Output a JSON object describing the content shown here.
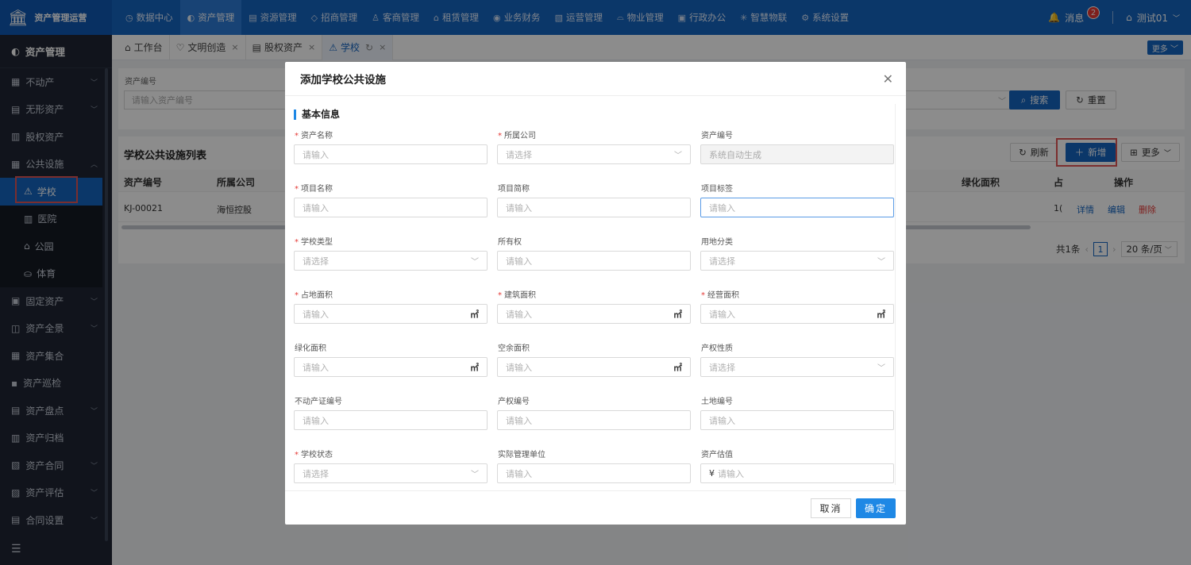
{
  "app": {
    "title": "资产管理运营",
    "logo_icon": "bank-icon"
  },
  "topnav": [
    {
      "label": "数据中心",
      "icon": "◷"
    },
    {
      "label": "资产管理",
      "icon": "◐",
      "active": true
    },
    {
      "label": "资源管理",
      "icon": "▤"
    },
    {
      "label": "招商管理",
      "icon": "◇"
    },
    {
      "label": "客商管理",
      "icon": "♙"
    },
    {
      "label": "租赁管理",
      "icon": "⌂"
    },
    {
      "label": "业务财务",
      "icon": "◉"
    },
    {
      "label": "运营管理",
      "icon": "▧"
    },
    {
      "label": "物业管理",
      "icon": "⌓"
    },
    {
      "label": "行政办公",
      "icon": "▣"
    },
    {
      "label": "智慧物联",
      "icon": "✳"
    },
    {
      "label": "系统设置",
      "icon": "⚙"
    }
  ],
  "topright": {
    "messages": "消息",
    "message_count": "2",
    "user": "测试01"
  },
  "sidebar": {
    "title": "资产管理",
    "items": [
      {
        "label": "不动产",
        "icon": "▦",
        "chevron": "﹀"
      },
      {
        "label": "无形资产",
        "icon": "▤",
        "chevron": "﹀"
      },
      {
        "label": "股权资产",
        "icon": "▥",
        "chevron": ""
      },
      {
        "label": "公共设施",
        "icon": "▦",
        "chevron": "︿"
      }
    ],
    "subitems": [
      {
        "label": "学校",
        "icon": "⚠",
        "active": true
      },
      {
        "label": "医院",
        "icon": "▥"
      },
      {
        "label": "公园",
        "icon": "⌂"
      },
      {
        "label": "体育",
        "icon": "⛀"
      }
    ],
    "items2": [
      {
        "label": "固定资产",
        "icon": "▣",
        "chevron": "﹀"
      },
      {
        "label": "资产全景",
        "icon": "◫",
        "chevron": "﹀"
      },
      {
        "label": "资产集合",
        "icon": "▦",
        "chevron": ""
      },
      {
        "label": "资产巡检",
        "icon": "▪",
        "chevron": ""
      },
      {
        "label": "资产盘点",
        "icon": "▤",
        "chevron": "﹀"
      },
      {
        "label": "资产归档",
        "icon": "▥",
        "chevron": ""
      },
      {
        "label": "资产合同",
        "icon": "▧",
        "chevron": "﹀"
      },
      {
        "label": "资产评估",
        "icon": "▨",
        "chevron": "﹀"
      },
      {
        "label": "合同设置",
        "icon": "▤",
        "chevron": "﹀"
      }
    ],
    "collapse_icon": "☰"
  },
  "tabs": [
    {
      "label": "工作台",
      "icon": "⌂",
      "close": ""
    },
    {
      "label": "文明创造",
      "icon": "♡",
      "close": "×"
    },
    {
      "label": "股权资产",
      "icon": "▤",
      "close": "×"
    },
    {
      "label": "学校",
      "icon": "⚠",
      "close": "×",
      "active": true,
      "refresh": "↻"
    }
  ],
  "tabs_more": "更多 ﹀",
  "search": {
    "label": "资产编号",
    "placeholder": "请输入资产编号",
    "search_btn": "搜索",
    "reset_btn": "重置"
  },
  "list": {
    "title": "学校公共设施列表",
    "refresh_btn": "刷新",
    "add_btn": "新增",
    "more_btn": "更多",
    "columns": {
      "c1": "资产编号",
      "c2": "所属公司",
      "c3": "绿化面积",
      "c4": "占",
      "c5": "操作"
    },
    "row": {
      "code": "KJ-00021",
      "company": "海恒控股",
      "partial": "1(",
      "detail": "详情",
      "edit": "编辑",
      "delete": "删除"
    },
    "pager": {
      "total": "共1条",
      "page": "1",
      "size": "20 条/页"
    }
  },
  "modal": {
    "title": "添加学校公共设施",
    "section": "基本信息",
    "fields": [
      {
        "label": "资产名称",
        "required": true,
        "placeholder": "请输入",
        "kind": "input"
      },
      {
        "label": "所属公司",
        "required": true,
        "placeholder": "请选择",
        "kind": "select"
      },
      {
        "label": "资产编号",
        "required": false,
        "placeholder": "系统自动生成",
        "kind": "disabled"
      },
      {
        "label": "项目名称",
        "required": true,
        "placeholder": "请输入",
        "kind": "input"
      },
      {
        "label": "项目简称",
        "required": false,
        "placeholder": "请输入",
        "kind": "input"
      },
      {
        "label": "项目标签",
        "required": false,
        "placeholder": "请输入",
        "kind": "focused"
      },
      {
        "label": "学校类型",
        "required": true,
        "placeholder": "请选择",
        "kind": "select"
      },
      {
        "label": "所有权",
        "required": false,
        "placeholder": "请输入",
        "kind": "input"
      },
      {
        "label": "用地分类",
        "required": false,
        "placeholder": "请选择",
        "kind": "select"
      },
      {
        "label": "占地面积",
        "required": true,
        "placeholder": "请输入",
        "kind": "area",
        "unit": "㎡"
      },
      {
        "label": "建筑面积",
        "required": true,
        "placeholder": "请输入",
        "kind": "area",
        "unit": "㎡"
      },
      {
        "label": "经营面积",
        "required": true,
        "placeholder": "请输入",
        "kind": "area",
        "unit": "㎡"
      },
      {
        "label": "绿化面积",
        "required": false,
        "placeholder": "请输入",
        "kind": "area",
        "unit": "㎡"
      },
      {
        "label": "空余面积",
        "required": false,
        "placeholder": "请输入",
        "kind": "area",
        "unit": "㎡"
      },
      {
        "label": "产权性质",
        "required": false,
        "placeholder": "请选择",
        "kind": "select"
      },
      {
        "label": "不动产证编号",
        "required": false,
        "placeholder": "请输入",
        "kind": "input"
      },
      {
        "label": "产权编号",
        "required": false,
        "placeholder": "请输入",
        "kind": "input"
      },
      {
        "label": "土地编号",
        "required": false,
        "placeholder": "请输入",
        "kind": "input"
      },
      {
        "label": "学校状态",
        "required": true,
        "placeholder": "请选择",
        "kind": "select"
      },
      {
        "label": "实际管理单位",
        "required": false,
        "placeholder": "请输入",
        "kind": "input"
      },
      {
        "label": "资产估值",
        "required": false,
        "placeholder": "请输入",
        "kind": "money",
        "prefix": "¥"
      }
    ],
    "cancel_btn": "取消",
    "ok_btn": "确定"
  },
  "colors": {
    "primary": "#1565c0",
    "accent": "#1e88e5",
    "danger": "#e53935",
    "sidebar": "#1f2633"
  }
}
